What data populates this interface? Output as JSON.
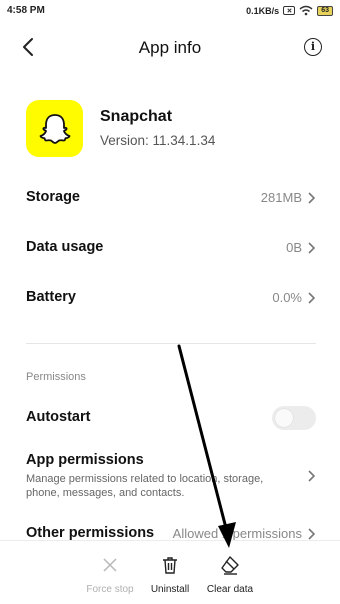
{
  "status_bar": {
    "time": "4:58 PM",
    "network_speed": "0.1KB/s",
    "battery_level": "63"
  },
  "header": {
    "title": "App info"
  },
  "app": {
    "name": "Snapchat",
    "version": "Version: 11.34.1.34",
    "icon_color": "#fffc00"
  },
  "rows": [
    {
      "label": "Storage",
      "value": "281MB"
    },
    {
      "label": "Data usage",
      "value": "0B"
    },
    {
      "label": "Battery",
      "value": "0.0%"
    }
  ],
  "permissions": {
    "section_label": "Permissions",
    "autostart": {
      "label": "Autostart",
      "enabled": false
    },
    "app_permissions": {
      "label": "App permissions",
      "description": "Manage permissions related to location, storage, phone, messages, and contacts."
    },
    "other_permissions": {
      "label": "Other permissions",
      "value": "Allowed 1 permissions"
    }
  },
  "bottom_bar": {
    "force_stop": "Force stop",
    "uninstall": "Uninstall",
    "clear_data": "Clear data"
  },
  "colors": {
    "annotation_arrow": "#000000"
  }
}
